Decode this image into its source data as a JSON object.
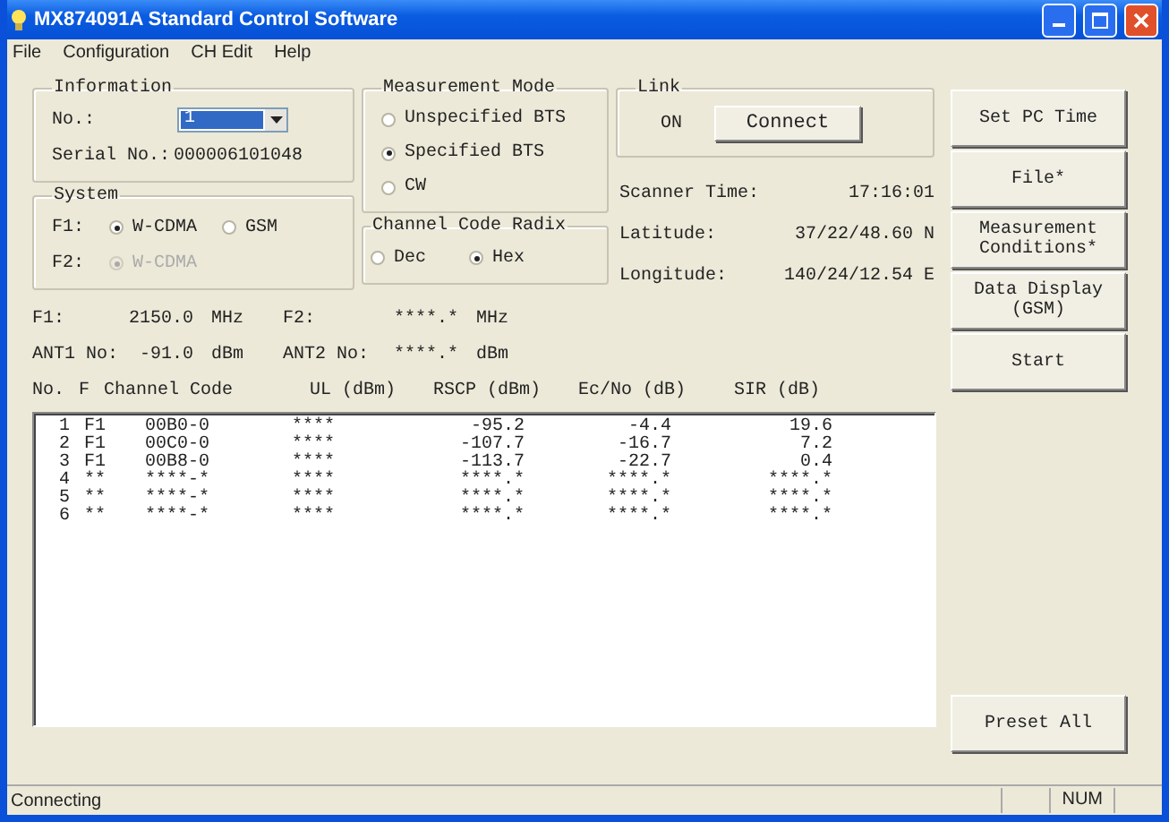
{
  "window": {
    "title": "MX874091A Standard Control Software"
  },
  "menu": [
    "File",
    "Configuration",
    "CH Edit",
    "Help"
  ],
  "information": {
    "title": "Information",
    "no_label": "No.:",
    "no_value": "1",
    "serial_label": "Serial No.:",
    "serial_value": "000006101048"
  },
  "system": {
    "title": "System",
    "f1_label": "F1:",
    "f1_options": [
      {
        "label": "W-CDMA",
        "selected": true,
        "disabled": false
      },
      {
        "label": "GSM",
        "selected": false,
        "disabled": false
      }
    ],
    "f2_label": "F2:",
    "f2_options": [
      {
        "label": "W-CDMA",
        "selected": true,
        "disabled": true
      }
    ]
  },
  "measurement_mode": {
    "title": "Measurement Mode",
    "options": [
      {
        "label": "Unspecified BTS",
        "selected": false
      },
      {
        "label": "Specified BTS",
        "selected": true
      },
      {
        "label": "CW",
        "selected": false
      }
    ]
  },
  "channel_code_radix": {
    "title": "Channel Code Radix",
    "options": [
      {
        "label": "Dec",
        "selected": false
      },
      {
        "label": "Hex",
        "selected": true
      }
    ]
  },
  "link": {
    "title": "Link",
    "status": "ON",
    "button": "Connect"
  },
  "scanner_info": [
    {
      "label": "Scanner Time:",
      "value": "17:16:01"
    },
    {
      "label": "Latitude:",
      "value": "37/22/48.60 N"
    },
    {
      "label": "Longitude:",
      "value": "140/24/12.54 E"
    }
  ],
  "readings": [
    [
      {
        "label": "F1:",
        "value": "2150.0",
        "unit": "MHz"
      },
      {
        "label": "F2:",
        "value": "****.*",
        "unit": "MHz"
      }
    ],
    [
      {
        "label": "ANT1 No:",
        "value": "-91.0",
        "unit": "dBm"
      },
      {
        "label": "ANT2 No:",
        "value": "****.*",
        "unit": "dBm"
      }
    ]
  ],
  "table": {
    "columns": [
      "No.",
      "F",
      "Channel Code",
      "UL (dBm)",
      "RSCP (dBm)",
      "Ec/No (dB)",
      "SIR (dB)"
    ],
    "rows": [
      [
        "1",
        "F1",
        "00B0-0",
        "****",
        "-95.2",
        "-4.4",
        "19.6"
      ],
      [
        "2",
        "F1",
        "00C0-0",
        "****",
        "-107.7",
        "-16.7",
        "7.2"
      ],
      [
        "3",
        "F1",
        "00B8-0",
        "****",
        "-113.7",
        "-22.7",
        "0.4"
      ],
      [
        "4",
        "**",
        "****-*",
        "****",
        "****.*",
        "****.*",
        "****.*"
      ],
      [
        "5",
        "**",
        "****-*",
        "****",
        "****.*",
        "****.*",
        "****.*"
      ],
      [
        "6",
        "**",
        "****-*",
        "****",
        "****.*",
        "****.*",
        "****.*"
      ]
    ]
  },
  "buttons": [
    "Set PC Time",
    "File*",
    "Measurement Conditions*",
    "Data Display (GSM)",
    "Start"
  ],
  "preset_button": "Preset All",
  "status_bar": {
    "text": "Connecting",
    "indicator": "NUM"
  }
}
